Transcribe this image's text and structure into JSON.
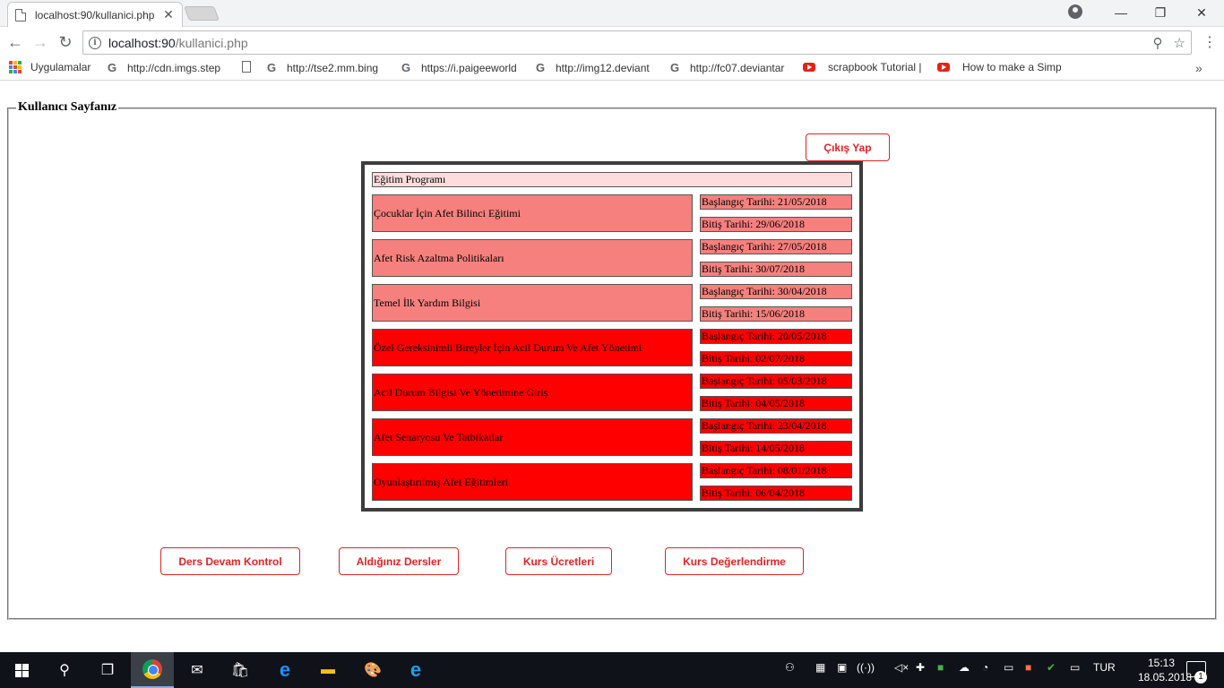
{
  "browser": {
    "tab_title": "localhost:90/kullanici.php",
    "url_host": "localhost:90",
    "url_path": "/kullanici.php",
    "bookmarks": [
      {
        "icon": "apps-icon",
        "label": "Uygulamalar"
      },
      {
        "icon": "google-icon",
        "label": "http://cdn.imgs.step"
      },
      {
        "icon": "document-icon",
        "label": ""
      },
      {
        "icon": "google-icon",
        "label": "http://tse2.mm.bing"
      },
      {
        "icon": "google-icon",
        "label": "https://i.paigeeworld"
      },
      {
        "icon": "google-icon",
        "label": "http://img12.deviant"
      },
      {
        "icon": "google-icon",
        "label": "http://fc07.deviantar"
      },
      {
        "icon": "youtube-icon",
        "label": "scrapbook Tutorial |"
      },
      {
        "icon": "youtube-icon",
        "label": "How to make a Simp"
      }
    ]
  },
  "page": {
    "legend": "Kullanıcı Sayfanız",
    "logout": "Çıkış Yap",
    "program_title": "Eğitim Programı",
    "courses": [
      {
        "name": "Çocuklar İçin Afet Bilinci Eğitimi",
        "start": "Başlangıç Tarihi: 21/05/2018",
        "end": "Bitiş Tarihi: 29/06/2018",
        "status_color": "#f5807d"
      },
      {
        "name": "Afet Risk Azaltma Politikaları",
        "start": "Başlangıç Tarihi: 27/05/2018",
        "end": "Bitiş Tarihi: 30/07/2018",
        "status_color": "#f5807d"
      },
      {
        "name": "Temel İlk Yardım Bilgisi",
        "start": "Başlangıç Tarihi: 30/04/2018",
        "end": "Bitiş Tarihi: 15/06/2018",
        "status_color": "#f5807d"
      },
      {
        "name": "Özel Gereksinimli Bireyler İçin Acil Durum Ve Afet Yönetimi",
        "start": "Başlangıç Tarihi: 20/05/2018",
        "end": "Bitiş Tarihi: 02/07/2018",
        "status_color": "#ff0000"
      },
      {
        "name": "Acil Durum Bilgisi Ve Yönetimine Giriş",
        "start": "Başlangıç Tarihi: 05/03/2018",
        "end": "Bitiş Tarihi: 04/05/2018",
        "status_color": "#ff0000"
      },
      {
        "name": "Afet Senaryosu Ve Tatbikatlar",
        "start": "Başlangıç Tarihi: 23/04/2018",
        "end": "Bitiş Tarihi: 14/05/2018",
        "status_color": "#ff0000"
      },
      {
        "name": "Oyunlaştırılmış Afet Eğitimleri",
        "start": "Başlangıç Tarihi: 08/01/2018",
        "end": "Bitiş Tarihi: 06/04/2018",
        "status_color": "#ff0000"
      }
    ],
    "nav_buttons": [
      "Ders Devam Kontrol",
      "Aldığınız Dersler",
      "Kurs Ücretleri",
      "Kurs Değerlendirme"
    ]
  },
  "taskbar": {
    "language": "TUR",
    "time": "15:13",
    "date": "18.05.2018",
    "notification_count": "1"
  },
  "colors": {
    "accent": "#e02424",
    "light_red": "#f5807d",
    "red": "#ff0000",
    "header_pink": "#fcdcdc"
  }
}
